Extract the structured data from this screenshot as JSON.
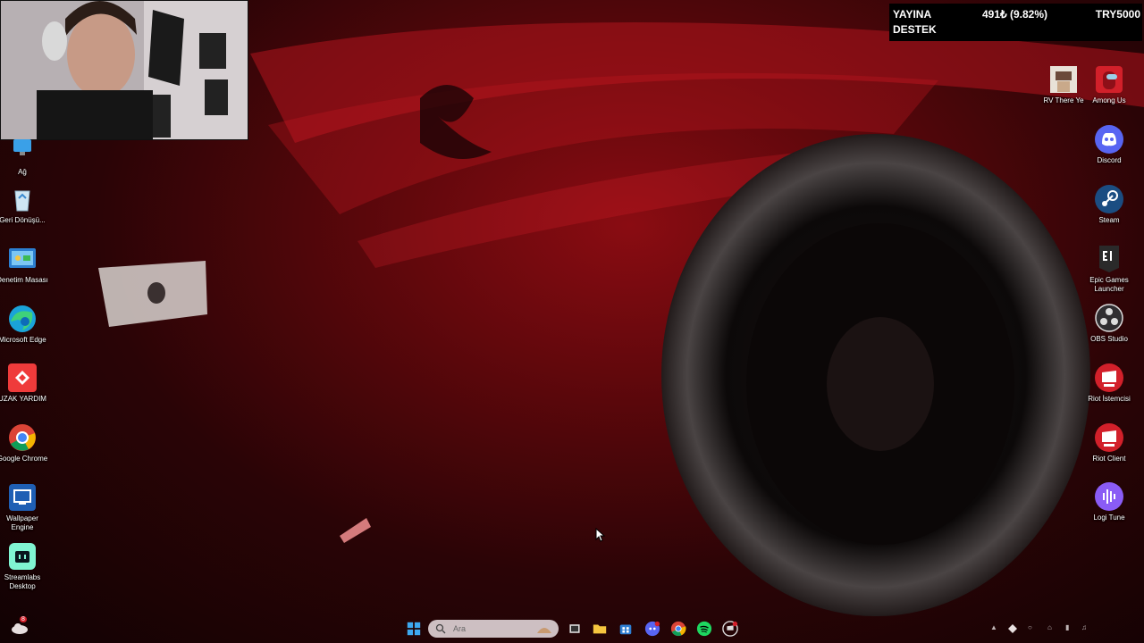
{
  "overlay": {
    "label_line1": "YAYINA",
    "label_line2": "DESTEK",
    "progress_text": "491₺ (9.82%)",
    "progress_fraction": 0.0982,
    "goal": "TRY5000"
  },
  "desktop_left": [
    {
      "label": "Ağ",
      "icon": "network-icon"
    },
    {
      "label": "Geri Dönüşü...",
      "icon": "recycle-bin-icon"
    },
    {
      "label": "Denetim Masası",
      "icon": "control-panel-icon"
    },
    {
      "label": "Microsoft Edge",
      "icon": "edge-icon"
    },
    {
      "label": "UZAK YARDIM",
      "icon": "remote-assist-icon"
    },
    {
      "label": "Google Chrome",
      "icon": "chrome-icon"
    },
    {
      "label": "Wallpaper Engine",
      "icon": "wallpaper-engine-icon"
    },
    {
      "label": "Streamlabs Desktop",
      "icon": "streamlabs-icon"
    }
  ],
  "desktop_right": [
    {
      "label": "RV There Ye",
      "icon": "rv-game-icon"
    },
    {
      "label": "Among Us",
      "icon": "among-us-icon"
    },
    {
      "label": "Discord",
      "icon": "discord-icon"
    },
    {
      "label": "Steam",
      "icon": "steam-icon"
    },
    {
      "label": "Epic Games Launcher",
      "icon": "epic-games-icon"
    },
    {
      "label": "OBS Studio",
      "icon": "obs-icon"
    },
    {
      "label": "Riot İstemcisi",
      "icon": "riot-icon"
    },
    {
      "label": "Riot Client",
      "icon": "riot-icon"
    },
    {
      "label": "Logi Tune",
      "icon": "logi-tune-icon"
    }
  ],
  "taskbar": {
    "search_placeholder": "Ara",
    "weather_badge": "8",
    "apps": [
      "start-icon",
      "task-view-icon",
      "file-explorer-icon",
      "store-icon",
      "discord-icon",
      "chrome-icon",
      "spotify-icon",
      "riot-icon"
    ]
  },
  "colors": {
    "overlay_bg": "#000000",
    "riot_red": "#d2202a",
    "discord_blurple": "#5865f2"
  }
}
